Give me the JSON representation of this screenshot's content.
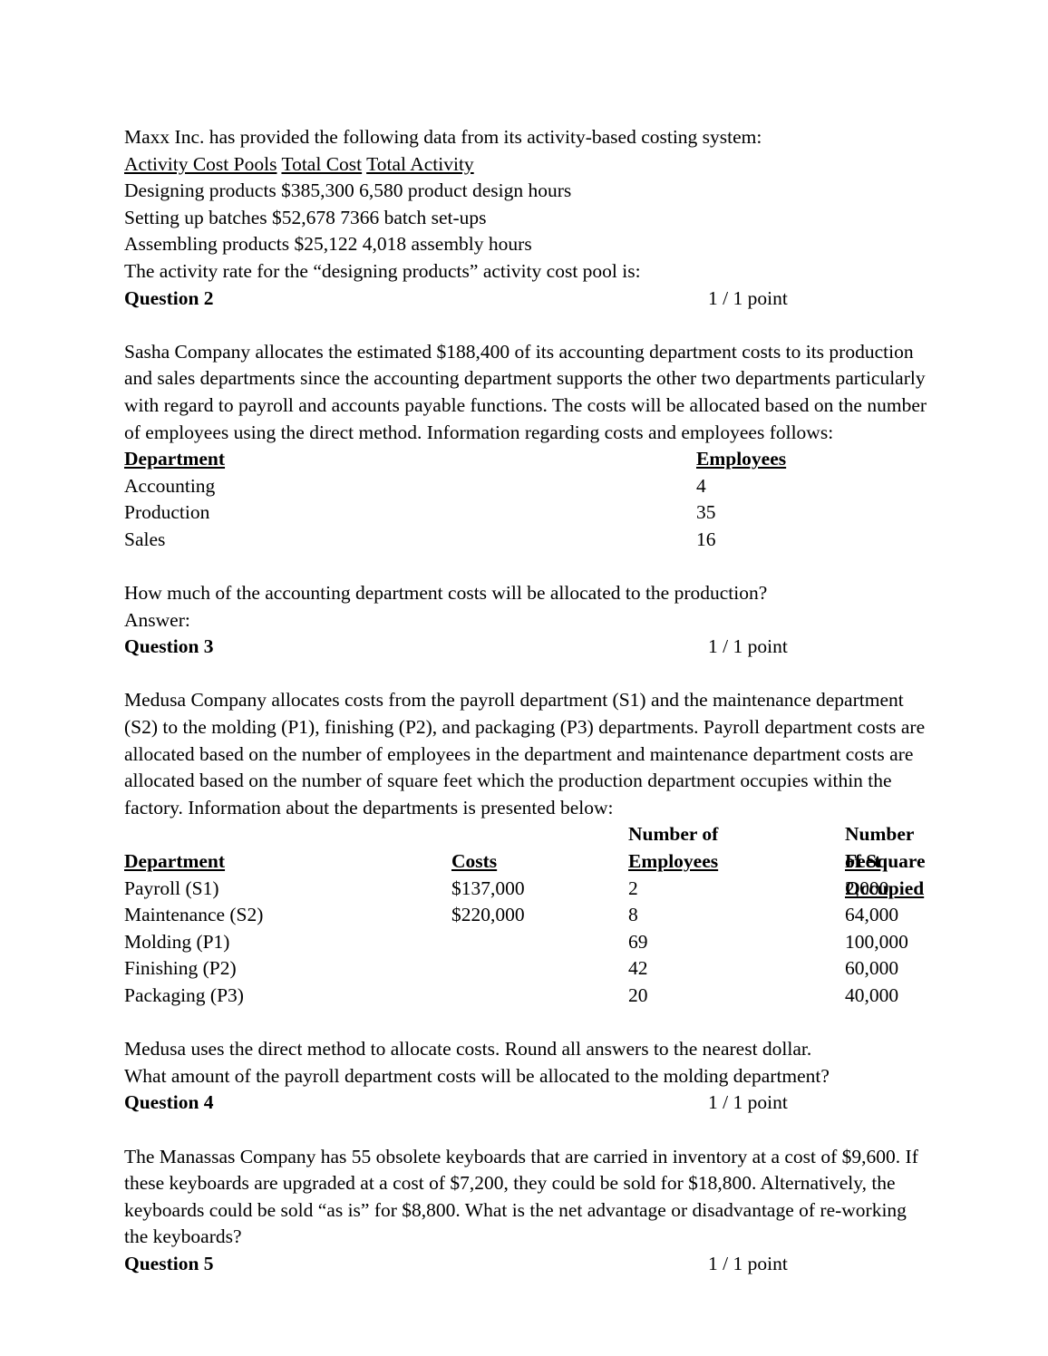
{
  "doc": {
    "q1_block": {
      "lines": [
        "Maxx Inc. has provided the following data from its activity-based costing system:",
        "Designing products $385,300 6,580 product design hours",
        "Setting up batches $52,678 7366 batch set-ups",
        "Assembling products $25,122 4,018 assembly hours",
        "The activity rate for the “designing products” activity cost pool is:"
      ],
      "header_line": {
        "col1": "Activity Cost Pools",
        "col2": "Total Cost",
        "col3": "Total Activity"
      }
    },
    "question2": {
      "label": "Question 2",
      "points": "1 / 1 point",
      "paragraph": "Sasha Company allocates the estimated $188,400 of its accounting department costs to its production and sales departments since the accounting department supports the other two departments particularly with regard to payroll and accounts payable functions. The costs will be allocated based on the number of employees using the direct method. Information regarding costs and employees follows:",
      "table": {
        "headers": [
          "Department",
          "Employees"
        ],
        "rows": [
          [
            "Accounting",
            "4"
          ],
          [
            "Production",
            "35"
          ],
          [
            "Sales",
            "16"
          ]
        ]
      },
      "question_line": "How much of the accounting department costs will be allocated to the production?",
      "answer_line": "Answer:"
    },
    "question3": {
      "label": "Question 3",
      "points": "1 / 1 point",
      "paragraph": "Medusa Company allocates costs from the payroll department (S1) and the maintenance department (S2) to the molding (P1), finishing (P2), and packaging (P3) departments. Payroll department costs are allocated based on the number of employees in the department and maintenance department costs are allocated based on the number of square feet which the production department occupies within the factory. Information about the departments is presented below:",
      "table": {
        "header_top": [
          "",
          "",
          "Number of",
          "Number of Square"
        ],
        "header_bottom": [
          "Department",
          "Costs",
          "Employees",
          "Feet Occupied"
        ],
        "rows": [
          [
            "Payroll (S1)",
            "$137,000",
            "2",
            "2,000"
          ],
          [
            "Maintenance (S2)",
            "$220,000",
            "8",
            "64,000"
          ],
          [
            "Molding (P1)",
            "",
            "69",
            "100,000"
          ],
          [
            "Finishing (P2)",
            "",
            "42",
            "60,000"
          ],
          [
            "Packaging (P3)",
            "",
            "20",
            "40,000"
          ]
        ]
      },
      "closing_line_1": "Medusa uses the direct method to allocate costs. Round all answers to the nearest dollar.",
      "closing_line_2": "What amount of the payroll department costs will be allocated to the molding department?"
    },
    "question4": {
      "label": "Question 4",
      "points": "1 / 1 point",
      "paragraph": "The Manassas Company has 55 obsolete keyboards that are carried in inventory at a cost of $9,600. If these keyboards are upgraded at a cost of $7,200, they could be sold for $18,800. Alternatively, the keyboards could be sold “as is” for $8,800. What is the net advantage or disadvantage of re-working the keyboards?"
    },
    "question5": {
      "label": "Question 5",
      "points": "1 / 1 point"
    }
  }
}
